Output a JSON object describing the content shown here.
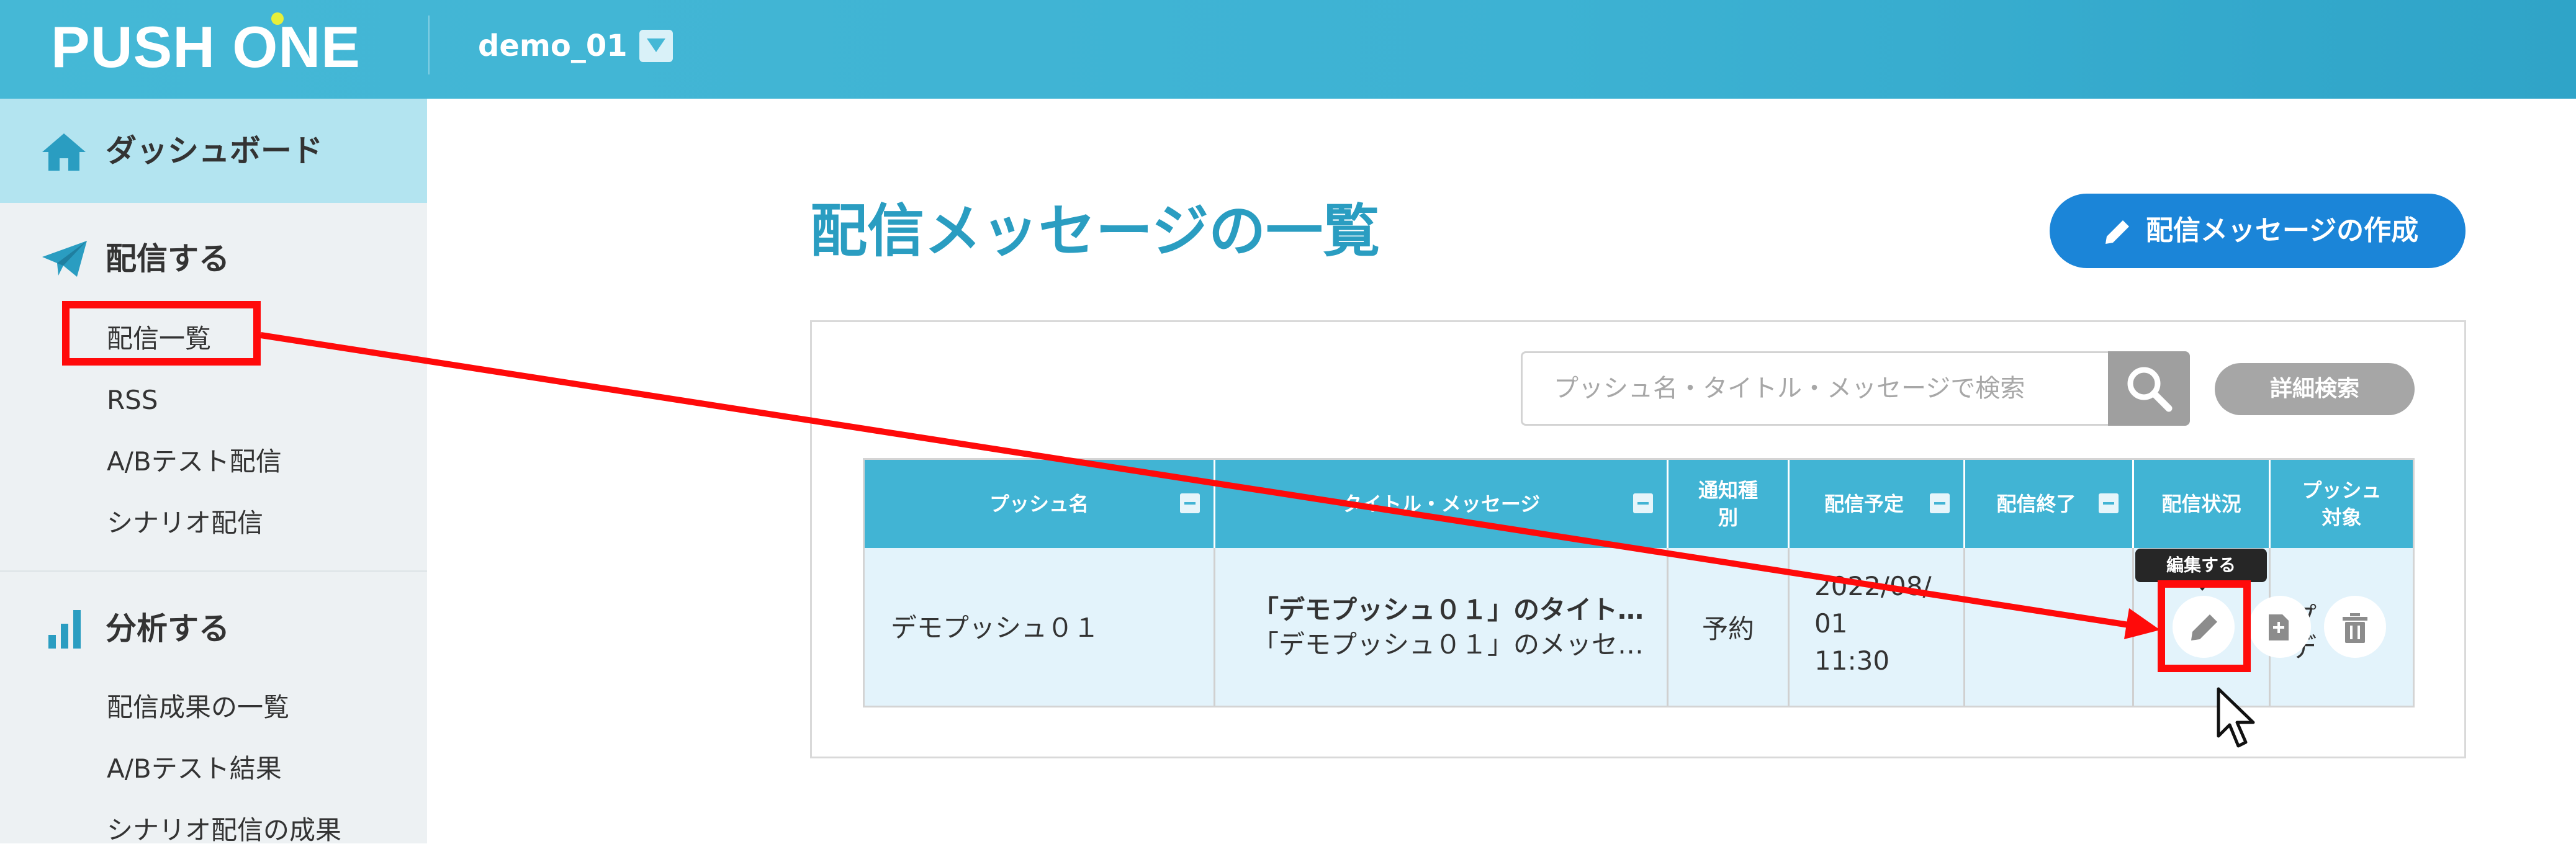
{
  "header": {
    "logo_text": "PUSH ONE",
    "project_name": "demo_01"
  },
  "sidebar": {
    "dashboard": {
      "label": "ダッシュボード",
      "icon": "home-icon"
    },
    "sections": [
      {
        "title": "配信する",
        "icon": "paper-plane-icon",
        "items": [
          "配信一覧",
          "RSS",
          "A/Bテスト配信",
          "シナリオ配信"
        ]
      },
      {
        "title": "分析する",
        "icon": "bar-chart-icon",
        "items": [
          "配信成果の一覧",
          "A/Bテスト結果",
          "シナリオ配信の成果"
        ]
      }
    ]
  },
  "main": {
    "page_title": "配信メッセージの一覧",
    "create_button_label": "配信メッセージの作成",
    "search": {
      "placeholder": "プッシュ名・タイトル・メッセージで検索",
      "advanced_label": "詳細検索"
    },
    "table": {
      "columns": [
        "プッシュ名",
        "タイトル・メッセージ",
        "通知種\n別",
        "配信予定",
        "配信終了",
        "配信状況",
        "プッシュ\n対象"
      ],
      "rows": [
        {
          "push_name": "デモプッシュ０１",
          "title": "「デモプッシュ０１」のタイト…",
          "message": "「デモプッシュ０１」のメッセ…",
          "notify_type": "予約",
          "schedule_line1": "2022/08/",
          "schedule_line2": "01",
          "schedule_line3": "11:30",
          "end": "",
          "target_fragment_1": "プ",
          "target_fragment_2": "デ"
        }
      ],
      "tooltip": "編集する"
    }
  },
  "colors": {
    "header": "#3db2d3",
    "accent": "#2a9dc1",
    "primary_button": "#1b85d8",
    "annotation": "#ff0a0a",
    "table_header": "#41b4d4",
    "table_row": "#e3f3fb"
  }
}
